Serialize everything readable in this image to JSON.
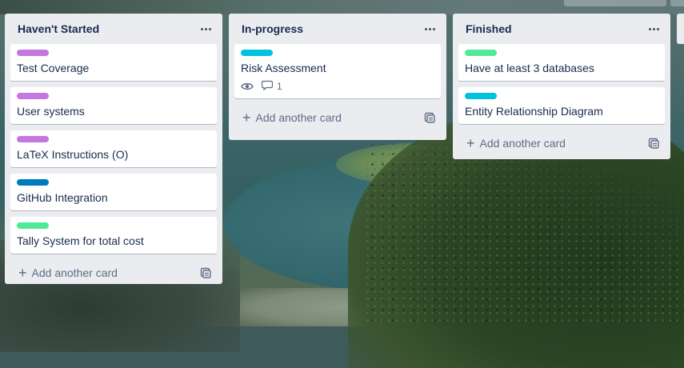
{
  "colors": {
    "purple": "#c377e0",
    "blue": "#0079bf",
    "green": "#51e898",
    "sky": "#00c2e0",
    "list_bg": "#ebecf0",
    "text": "#172b4d"
  },
  "icons": {
    "more": "ellipsis-icon",
    "add": "plus-icon",
    "template": "card-template-icon",
    "watch": "eye-icon",
    "comments": "speech-bubble-icon"
  },
  "lists": [
    {
      "title": "Haven't Started",
      "add_label": "Add another card",
      "cards": [
        {
          "label_color": "#c377e0",
          "title": "Test Coverage"
        },
        {
          "label_color": "#c377e0",
          "title": "User systems"
        },
        {
          "label_color": "#c377e0",
          "title": "LaTeX Instructions (O)"
        },
        {
          "label_color": "#0079bf",
          "title": "GitHub Integration"
        },
        {
          "label_color": "#51e898",
          "title": "Tally System for total cost"
        }
      ]
    },
    {
      "title": "In-progress",
      "add_label": "Add another card",
      "cards": [
        {
          "label_color": "#00c2e0",
          "title": "Risk Assessment",
          "watching": true,
          "comments": "1"
        }
      ]
    },
    {
      "title": "Finished",
      "add_label": "Add another card",
      "cards": [
        {
          "label_color": "#51e898",
          "title": "Have at least 3 databases"
        },
        {
          "label_color": "#00c2e0",
          "title": "Entity Relationship Diagram"
        }
      ]
    }
  ]
}
